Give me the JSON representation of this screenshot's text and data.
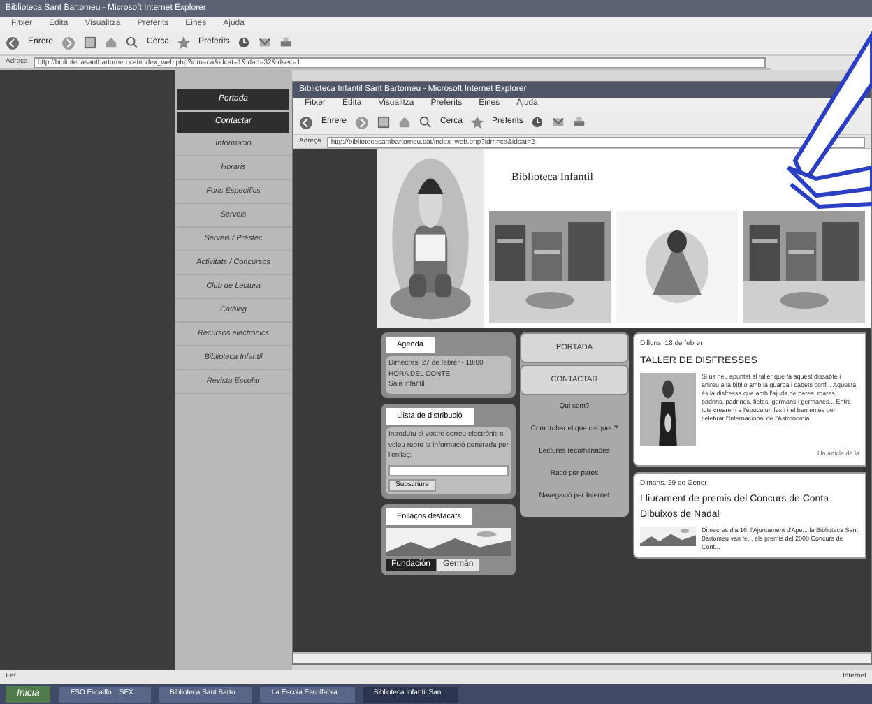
{
  "browser": {
    "title": "Biblioteca Sant Bartomeu - Microsoft Internet Explorer",
    "menu": [
      "Fitxer",
      "Edita",
      "Visualitza",
      "Preferits",
      "Eines",
      "Ajuda"
    ],
    "back": "Enrere",
    "search": "Cerca",
    "favorites": "Preferits",
    "address_label": "Adreça",
    "url": "http://bibliotecasantbartomeu.cat/index_web.php?idm=ca&idcat=1&idart=32&idsec=1"
  },
  "nav": [
    {
      "label": "Portada",
      "highlighted": true
    },
    {
      "label": "Contactar",
      "highlighted": true
    },
    {
      "label": "Informació",
      "highlighted": false
    },
    {
      "label": "Horaris",
      "highlighted": false
    },
    {
      "label": "Fons Específics",
      "highlighted": false
    },
    {
      "label": "Serveis",
      "highlighted": false
    },
    {
      "label": "Serveis / Préstec",
      "highlighted": false
    },
    {
      "label": "Activitats / Concursos",
      "highlighted": false
    },
    {
      "label": "Club de Lectura",
      "highlighted": false
    },
    {
      "label": "Catàleg",
      "highlighted": false
    },
    {
      "label": "Recursos electrònics",
      "highlighted": false
    },
    {
      "label": "Biblioteca Infantil",
      "highlighted": false
    },
    {
      "label": "Revista Escolar",
      "highlighted": false
    }
  ],
  "inner": {
    "title": "Biblioteca Infantil Sant Bartomeu - Microsoft Internet Explorer",
    "menu": [
      "Fitxer",
      "Edita",
      "Visualitza",
      "Preferits",
      "Eines",
      "Ajuda"
    ],
    "back": "Enrere",
    "search": "Cerca",
    "favorites": "Preferits",
    "address_label": "Adreça",
    "url": "http://bibliotecasantbartomeu.cat/index_web.php?idm=ca&idcat=2"
  },
  "header_title": "Biblioteca Infantil",
  "agenda": {
    "title": "Agenda",
    "date": "Dimecres, 27 de febrer - 18:00",
    "event": "HORA DEL CONTE",
    "place": "Sala infantil"
  },
  "mailing": {
    "title": "Llista de distribució",
    "text": "Introduïu el vostre correu electrònic si voleu rebre la informació generada per l'enllaç:",
    "button": "Subscriure"
  },
  "links": {
    "title": "Enllaços destacats",
    "tabs": [
      {
        "label": "Fundación",
        "selected": true
      },
      {
        "label": "Germán",
        "selected": false
      }
    ]
  },
  "menu": [
    {
      "label": "PORTADA",
      "kind": "main"
    },
    {
      "label": "CONTACTAR",
      "kind": "main"
    },
    {
      "label": "Qui som?",
      "kind": "sub"
    },
    {
      "label": "Com trobar el que cerqueu?",
      "kind": "sub"
    },
    {
      "label": "Lectures recomanades",
      "kind": "sub"
    },
    {
      "label": "Racó per pares",
      "kind": "sub"
    },
    {
      "label": "Navegació per Internet",
      "kind": "sub"
    }
  ],
  "news": [
    {
      "date": "Dilluns, 18 de febrer",
      "title": "TALLER DE DISFRESSES",
      "text": "Si us heu apuntat al taller que fa aquest dissabte i anireu a la biblio amb la guarda i cabets conf... Aquesta és la disfressa que amb l'ajuda de pares, mares, padrins, padrines, tietes, germans i germanes... Entre tots crearem a l'època un festí i el ben entès per celebrar l'Internacional de l'Astronomia.",
      "more": "Un article de la"
    },
    {
      "date": "Dimarts, 29 de Gener",
      "title": "Lliurament de premis del Concurs de Conta",
      "title2": "Dibuixos de Nadal",
      "text": "Dimecres dia 16, l'Ajuntament d'Ape... la Biblioteca Sant Bartomeu van fe... els premis del 2008 Concurs de Cont..."
    }
  ],
  "status": {
    "text": "Fet",
    "zone": "Internet"
  },
  "taskbar": {
    "start": "Inicia",
    "tasks": [
      {
        "label": "ESO Escaiflo... SEX...",
        "active": false
      },
      {
        "label": "Biblioteca Sant Barto...",
        "active": false
      },
      {
        "label": "La Escola Escolfabra...",
        "active": false
      },
      {
        "label": "Biblioteca Infantil San...",
        "active": true
      }
    ]
  }
}
